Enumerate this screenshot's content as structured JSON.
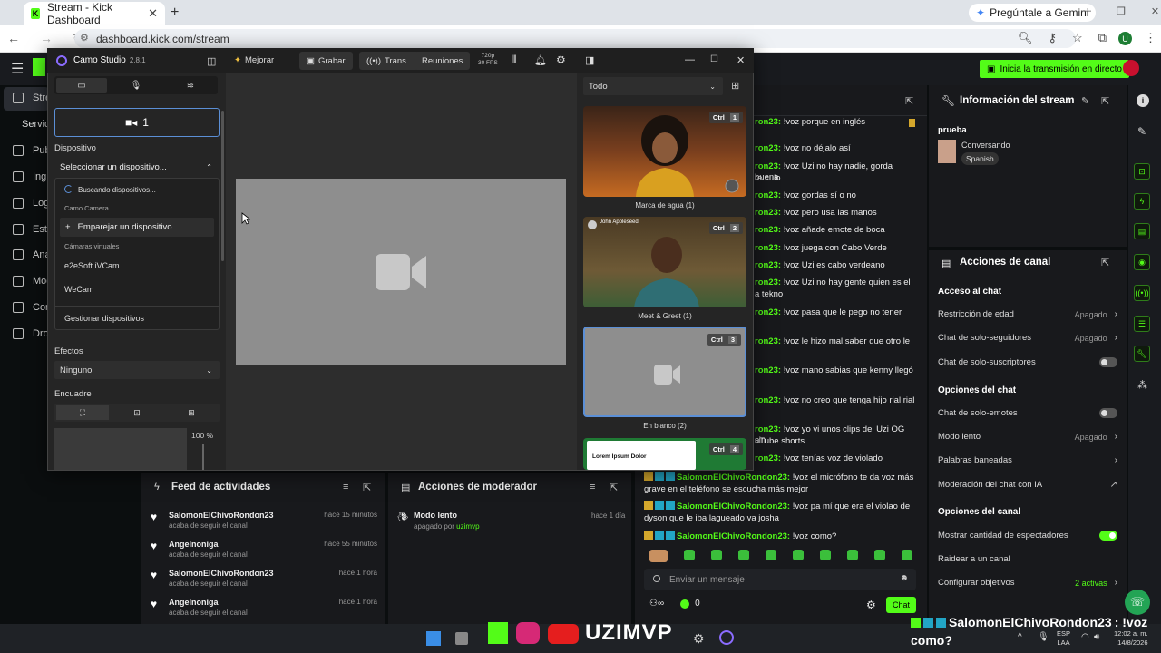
{
  "browser": {
    "tab_title": "Stream - Kick Dashboard",
    "url": "dashboard.kick.com/stream",
    "gemini_label": "Pregúntale a Gemini",
    "profile_initial": "U"
  },
  "kick": {
    "go_live": "Inicia la transmisión en directo",
    "sidebar": [
      {
        "label": "Strea"
      },
      {
        "label": "Servid"
      },
      {
        "label": "Publi"
      },
      {
        "label": "Ingre"
      },
      {
        "label": "Logr"
      },
      {
        "label": "Estu"
      },
      {
        "label": "Anal"
      },
      {
        "label": "Mod"
      },
      {
        "label": "Com"
      },
      {
        "label": "Drop"
      }
    ],
    "chat": {
      "lines": [
        {
          "user": "ron23:",
          "text": "!voz porque en inglés"
        },
        {
          "user": "ron23:",
          "text": "!voz no déjalo así"
        },
        {
          "user": "ron23:",
          "text": "!voz Uzi no hay nadie, gorda buena"
        },
        {
          "user": "",
          "text": "re culo"
        },
        {
          "user": "ron23:",
          "text": "!voz gordas sí o no"
        },
        {
          "user": "ron23:",
          "text": "!voz pero usa las manos"
        },
        {
          "user": "ron23:",
          "text": "!voz añade emote de boca"
        },
        {
          "user": "ron23:",
          "text": "!voz juega con Cabo Verde"
        },
        {
          "user": "ron23:",
          "text": "!voz Uzi es cabo verdeano"
        },
        {
          "user": "ron23:",
          "text": "!voz Uzi no hay gente quien es el"
        },
        {
          "user": "",
          "text": "a tekno"
        },
        {
          "user": "ron23:",
          "text": "!voz pasa que le pego no tener"
        },
        {
          "user": "ron23:",
          "text": "!voz le hizo mal saber que otro le"
        },
        {
          "user": "ron23:",
          "text": "!voz mano sabias que kenny llegó"
        },
        {
          "user": "ron23:",
          "text": "!voz no creo que tenga hijo rial rial"
        },
        {
          "user": "ron23:",
          "text": "!voz yo vi unos clips del Uzi OG sin"
        },
        {
          "user": "",
          "text": "uTube shorts"
        },
        {
          "user": "ron23:",
          "text": "!voz tenías voz de violado"
        }
      ],
      "full_lines": [
        {
          "user": "SalomonElChivoRondon23:",
          "text": "!voz el micrófono te da voz más grave en el teléfono se escucha más mejor"
        },
        {
          "user": "SalomonElChivoRondon23:",
          "text": "!voz pa mí que era el violao de dyson que le iba lagueado va josha"
        },
        {
          "user": "SalomonElChivoRondon23:",
          "text": "!voz como?"
        }
      ],
      "placeholder": "Enviar un mensaje",
      "count": "0",
      "chat_button": "Chat"
    },
    "stream_info": {
      "title": "Información del stream",
      "stream_title": "prueba",
      "category": "Conversando",
      "language": "Spanish"
    },
    "channel_actions": {
      "title": "Acciones de canal",
      "sections": [
        {
          "heading": "Acceso al chat"
        },
        {
          "heading": "Opciones del chat"
        },
        {
          "heading": "Opciones del canal"
        }
      ],
      "rows": {
        "age": {
          "label": "Restricción de edad",
          "value": "Apagado"
        },
        "followers": {
          "label": "Chat de solo-seguidores",
          "value": "Apagado"
        },
        "subs": {
          "label": "Chat de solo-suscriptores"
        },
        "emotes": {
          "label": "Chat de solo-emotes"
        },
        "slow": {
          "label": "Modo lento",
          "value": "Apagado"
        },
        "banned": {
          "label": "Palabras baneadas"
        },
        "ai": {
          "label": "Moderación del chat con IA"
        },
        "viewers": {
          "label": "Mostrar cantidad de espectadores"
        },
        "raid": {
          "label": "Raidear a un canal"
        },
        "goals": {
          "label": "Configurar objetivos",
          "value": "2 activas"
        }
      }
    },
    "activity_feed": {
      "title": "Feed de actividades",
      "items": [
        {
          "name": "SalomonElChivoRondon23",
          "action": "acaba de seguir el canal",
          "time": "hace 15 minutos"
        },
        {
          "name": "AngeInoniga",
          "action": "acaba de seguir el canal",
          "time": "hace 55 minutos"
        },
        {
          "name": "SalomonElChivoRondon23",
          "action": "acaba de seguir el canal",
          "time": "hace 1 hora"
        },
        {
          "name": "AngeInoniga",
          "action": "acaba de seguir el canal",
          "time": "hace 1 hora"
        }
      ]
    },
    "mod_actions": {
      "title": "Acciones de moderador",
      "items": [
        {
          "name": "Modo lento",
          "action": "apagado por",
          "user": "uzimvp",
          "time": "hace 1 día"
        }
      ]
    }
  },
  "camo": {
    "app_name": "Camo Studio",
    "version": "2.8.1",
    "upgrade": "Mejorar",
    "record": "Grabar",
    "transmit": "Trans...",
    "meetings": "Reuniones",
    "resolution": "720p",
    "fps": "30 FPS",
    "source_number": "1",
    "device_label": "Dispositivo",
    "device_select": "Seleccionar un dispositivo...",
    "dropdown": {
      "searching": "Buscando dispositivos...",
      "camo_camera": "Camo Camera",
      "pair": "Emparejar un dispositivo",
      "virtual": "Cámaras virtuales",
      "vcam": "e2eSoft iVCam",
      "wecam": "WeCam",
      "manage": "Gestionar dispositivos"
    },
    "effects_label": "Efectos",
    "effects_value": "Ninguno",
    "framing_label": "Encuadre",
    "zoom": "100 %",
    "scenes_filter": "Todo",
    "scenes": [
      {
        "label": "Marca de agua (1)",
        "key": "1"
      },
      {
        "label": "Meet & Greet (1)",
        "key": "2",
        "person": "John Appleseed"
      },
      {
        "label": "En blanco (2)",
        "key": "3"
      },
      {
        "label": "",
        "key": "4",
        "card": "Lorem Ipsum Dolor"
      }
    ],
    "ctrl": "Ctrl"
  },
  "overlay": {
    "user": "SalomonElChivoRondon23",
    "text": ": !voz",
    "text2": "como?"
  },
  "taskbar": {
    "brand": "UZIMVP",
    "lang1": "ESP",
    "lang2": "LAA",
    "time": "12:02 a. m.",
    "date": "14/8/2026"
  }
}
